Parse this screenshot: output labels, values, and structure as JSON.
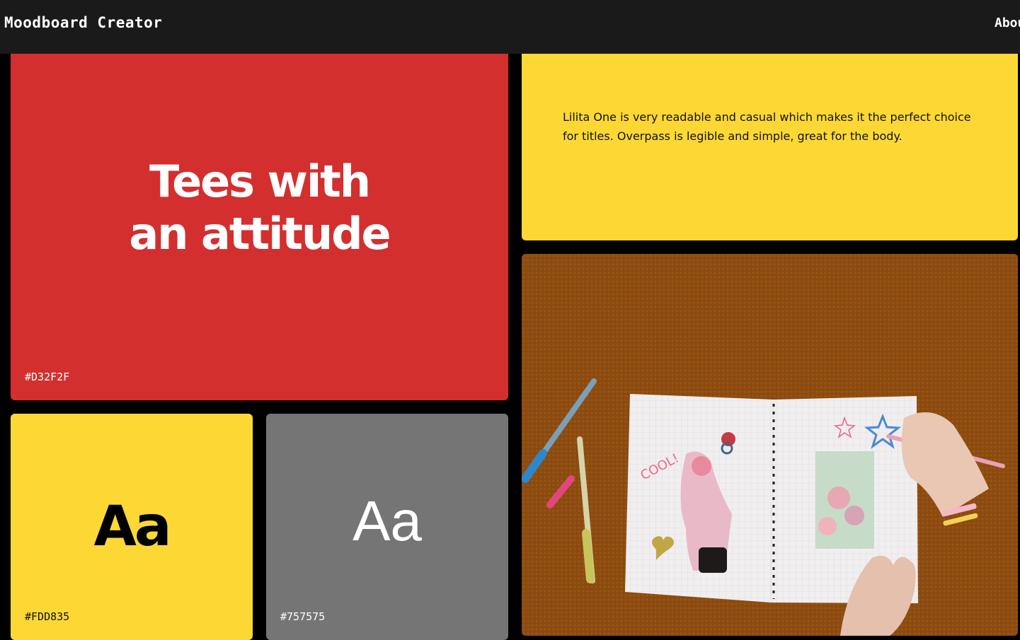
{
  "header": {
    "brand": "Moodboard Creator",
    "nav_about": "About"
  },
  "colors": {
    "red": "#D32F2F",
    "yellow": "#FDD835",
    "grey": "#757575",
    "topbar": "#1a1a1a",
    "background": "#000000"
  },
  "hero": {
    "line1": "Tees with",
    "line2": "an attitude",
    "color_code": "#D32F2F"
  },
  "typography_note": {
    "text": "Lilita One is very readable and casual which makes it the perfect choice for titles. Overpass is legible and simple, great for the body."
  },
  "font_samples": [
    {
      "sample": "Aa",
      "color_code": "#FDD835"
    },
    {
      "sample": "Aa",
      "color_code": "#757575"
    }
  ],
  "photo": {
    "icon": "scrapbook-photo-image"
  }
}
